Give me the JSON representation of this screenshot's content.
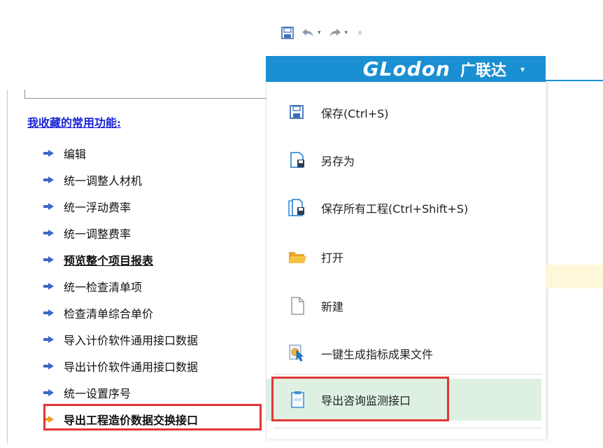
{
  "left_panel": {
    "title": "我收藏的常用功能:",
    "items": [
      {
        "label": "编辑"
      },
      {
        "label": "统一调整人材机"
      },
      {
        "label": "统一浮动费率"
      },
      {
        "label": "统一调整费率"
      },
      {
        "label": "预览整个项目报表"
      },
      {
        "label": "统一检查清单项"
      },
      {
        "label": "检查清单综合单价"
      },
      {
        "label": "导入计价软件通用接口数据"
      },
      {
        "label": "导出计价软件通用接口数据"
      },
      {
        "label": "统一设置序号"
      },
      {
        "label": "导出工程造价数据交换接口"
      }
    ]
  },
  "brand": {
    "logo_text": "GLodon",
    "cn": "广联达",
    "caret": "▾"
  },
  "quick_access": {
    "undo_caret": "▾",
    "redo_caret": "▾",
    "more": "⩡"
  },
  "menu": {
    "items": [
      {
        "label": "保存(Ctrl+S)",
        "icon": "save-icon"
      },
      {
        "label": "另存为",
        "icon": "save-as-icon"
      },
      {
        "label": "保存所有工程(Ctrl+Shift+S)",
        "icon": "save-all-icon"
      },
      {
        "label": "打开",
        "icon": "folder-icon"
      },
      {
        "label": "新建",
        "icon": "new-file-icon"
      },
      {
        "label": "一键生成指标成果文件",
        "icon": "generate-icon"
      },
      {
        "label": "导出咨询监测接口",
        "icon": "export-xml-icon"
      }
    ]
  },
  "colors": {
    "brand_blue": "#1a8fd2",
    "link_blue": "#1a23d6",
    "highlight_green": "#ddf0e2",
    "annotation_red": "#e23535"
  }
}
